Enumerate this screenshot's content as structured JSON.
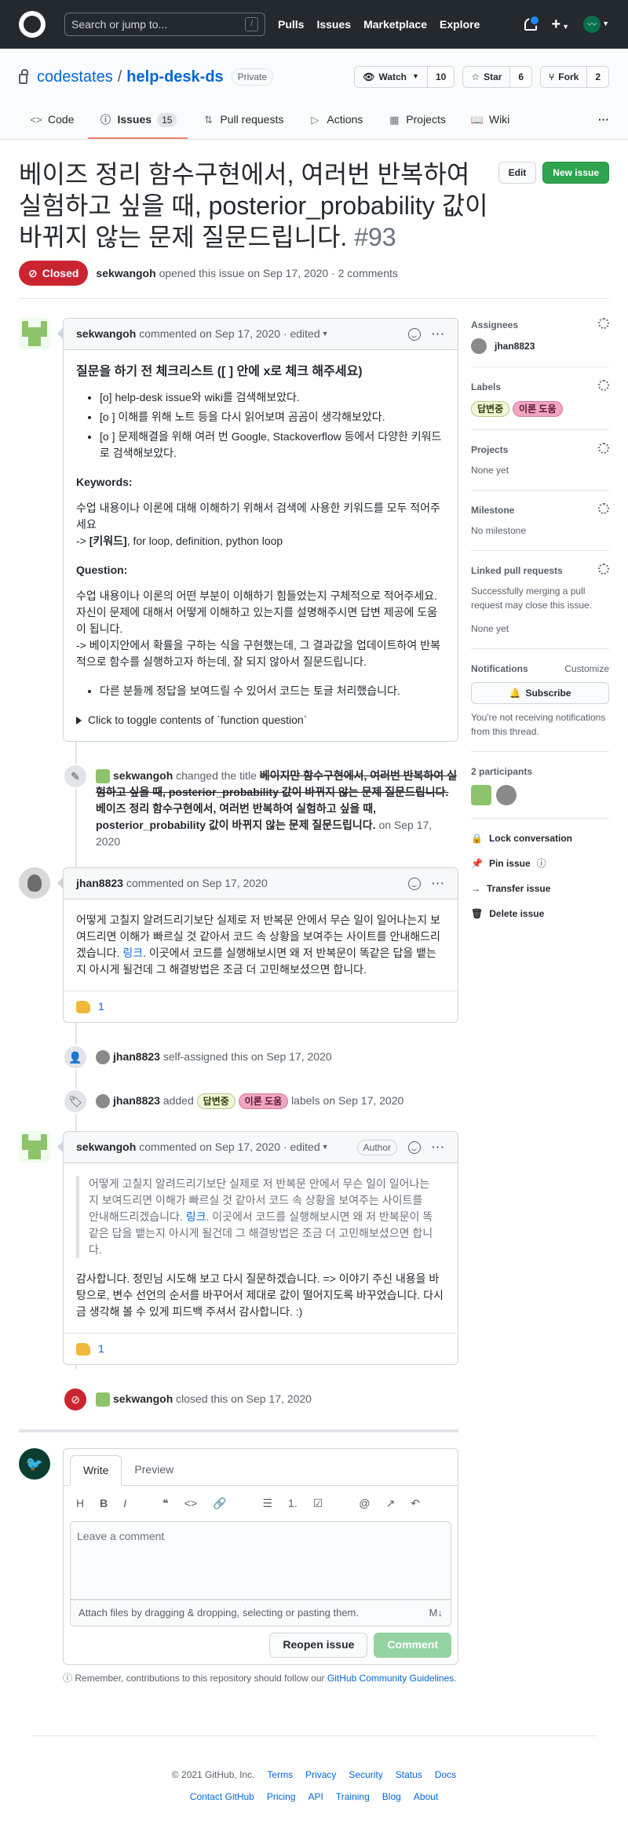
{
  "header": {
    "search_placeholder": "Search or jump to...",
    "search_key": "/",
    "nav": [
      "Pulls",
      "Issues",
      "Marketplace",
      "Explore"
    ]
  },
  "repo": {
    "owner": "codestates",
    "name": "help-desk-ds",
    "visibility": "Private",
    "watch_label": "Watch",
    "watch_count": "10",
    "star_label": "Star",
    "star_count": "6",
    "fork_label": "Fork",
    "fork_count": "2",
    "tabs": [
      {
        "label": "Code",
        "icon": "code-icon"
      },
      {
        "label": "Issues",
        "count": "15",
        "icon": "issue-icon"
      },
      {
        "label": "Pull requests",
        "icon": "pull-request-icon"
      },
      {
        "label": "Actions",
        "icon": "play-icon"
      },
      {
        "label": "Projects",
        "icon": "project-icon"
      },
      {
        "label": "Wiki",
        "icon": "book-icon"
      }
    ]
  },
  "issue": {
    "title": "베이즈 정리 함수구현에서, 여러번 반복하여 실험하고 싶을 때, posterior_probability 값이 바뀌지 않는 문제 질문드립니다.",
    "number": "#93",
    "edit_label": "Edit",
    "new_issue_label": "New issue",
    "state": "Closed",
    "author": "sekwangoh",
    "meta": "opened this issue on Sep 17, 2020 · 2 comments"
  },
  "comments": {
    "first": {
      "author": "sekwangoh",
      "meta": "commented on Sep 17, 2020",
      "edited": "· edited",
      "checklist_title": "질문을 하기 전 체크리스트 ([ ] 안에 x로 체크 해주세요)",
      "checklist": [
        "[o] help-desk issue와 wiki를 검색해보았다.",
        "[o ] 이해를 위해 노트 등을 다시 읽어보며 곰곰이 생각해보았다.",
        "[o ] 문제해결을 위해 여러 번 Google, Stackoverflow 등에서 다양한 키워드로 검색해보았다."
      ],
      "keywords_h": "Keywords:",
      "keywords_p1": "수업 내용이나 이론에 대해 이해하기 위해서 검색에 사용한 키워드를 모두 적어주세요",
      "keywords_p2_prefix": "-> ",
      "keywords_p2_bold": "[키워드]",
      "keywords_p2_rest": ", for loop, definition, python loop",
      "question_h": "Question:",
      "question_p": "수업 내용이나 이론의 어떤 부분이 이해하기 힘들었는지 구체적으로 적어주세요. 자신이 문제에 대해서 어떻게 이해하고 있는지를 설명해주시면 답변 제공에 도움이 됩니다.",
      "question_p2": "-> 베이지안에서 확률을 구하는 식을 구현했는데, 그 결과값을 업데이트하여 반복적으로 함수를 실행하고자 하는데, 잘 되지 않아서 질문드립니다.",
      "bullet": "다른 분들께 정답을 보여드릴 수 있어서 코드는 토글 처리했습니다.",
      "toggle": "Click to toggle contents of `function question`"
    },
    "rename": {
      "author": "sekwangoh",
      "action": "changed the title",
      "old": "베이지만 함수구현에서, 여러번 반복하여 실험하고 싶을 때, posterior_probability 값이 바뀌지 않는 문제 질문드립니다.",
      "new": "베이즈 정리 함수구현에서, 여러번 반복하여 실험하고 싶을 때, posterior_probability 값이 바뀌지 않는 문제 질문드립니다.",
      "date": "on Sep 17, 2020"
    },
    "second": {
      "author": "jhan8823",
      "meta": "commented on Sep 17, 2020",
      "body_a": "어떻게 고칠지 알려드리기보단 실제로 저 반복문 안에서 무슨 일이 일어나는지 보여드리면 이해가 빠르실 것 같아서 코드 속 상황을 보여주는 사이트를 안내해드리겠습니다. ",
      "link": "링크",
      "body_b": ". 이곳에서 코드를 실행해보시면 왜 저 반복문이 똑같은 답을 뱉는지 아시게 될건데 그 해결방법은 조금 더 고민해보셨으면 합니다.",
      "reaction": "1"
    },
    "assign": {
      "author": "jhan8823",
      "text": "self-assigned this on Sep 17, 2020"
    },
    "labeled": {
      "author": "jhan8823",
      "added": "added",
      "labels_word": "labels on Sep 17, 2020"
    },
    "third": {
      "author": "sekwangoh",
      "meta": "commented on Sep 17, 2020",
      "edited": "· edited",
      "author_badge": "Author",
      "quote_a": "어떻게 고칠지 알려드리기보단 실제로 저 반복문 안에서 무슨 일이 일어나는지 보여드리면 이해가 빠르실 것 같아서 코드 속 상황을 보여주는 사이트를 안내해드리겠습니다. ",
      "quote_link": "링크",
      "quote_b": ". 이곳에서 코드를 실행해보시면 왜 저 반복문이 똑같은 답을 뱉는지 아시게 될건데 그 해결방법은 조금 더 고민해보셨으면 합니다.",
      "body": "감사합니다. 정민님 시도해 보고 다시 질문하겠습니다. => 이야기 주신 내용을 바탕으로, 변수 선언의 순서를 바꾸어서 제대로 값이 떨어지도록 바꾸었습니다. 다시금 생각해 볼 수 있게 피드백 주셔서 감사합니다. :)",
      "reaction": "1"
    },
    "closed": {
      "author": "sekwangoh",
      "text": "closed this on Sep 17, 2020"
    }
  },
  "labels": {
    "a": "답변중",
    "b": "이론 도움",
    "a_color": "#f1f8d6",
    "b_color": "#f0a5c1"
  },
  "composer": {
    "tab_write": "Write",
    "tab_preview": "Preview",
    "toolbar": [
      "H",
      "B",
      "I",
      "❝",
      "<>",
      "🔗",
      "☰",
      "1.",
      "☑",
      "@",
      "↗",
      "↶"
    ],
    "placeholder": "Leave a comment",
    "attach": "Attach files by dragging & dropping, selecting or pasting them.",
    "reopen": "Reopen issue",
    "comment": "Comment",
    "remember_a": "Remember, contributions to this repository should follow our ",
    "remember_link": "GitHub Community Guidelines",
    "remember_b": "."
  },
  "sidebar": {
    "assignees_h": "Assignees",
    "assignee": "jhan8823",
    "labels_h": "Labels",
    "projects_h": "Projects",
    "projects_v": "None yet",
    "milestone_h": "Milestone",
    "milestone_v": "No milestone",
    "linked_h": "Linked pull requests",
    "linked_note": "Successfully merging a pull request may close this issue.",
    "linked_v": "None yet",
    "notif_h": "Notifications",
    "customize": "Customize",
    "subscribe": "Subscribe",
    "notif_note": "You're not receiving notifications from this thread.",
    "participants_h": "2 participants",
    "lock": "Lock conversation",
    "pin": "Pin issue",
    "transfer": "Transfer issue",
    "delete": "Delete issue"
  },
  "footer": {
    "copyright": "© 2021 GitHub, Inc.",
    "row1": [
      "Terms",
      "Privacy",
      "Security",
      "Status",
      "Docs"
    ],
    "row2": [
      "Contact GitHub",
      "Pricing",
      "API",
      "Training",
      "Blog",
      "About"
    ]
  },
  "colors": {
    "header_bg": "#24292e",
    "closed_red": "#cb2431",
    "new_issue_green": "#2ea44f",
    "link_blue": "#0366d6"
  }
}
